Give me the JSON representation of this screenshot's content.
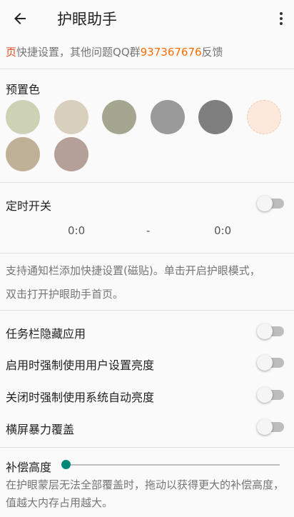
{
  "appbar": {
    "title": "护眼助手",
    "back_icon": "arrow-back-icon",
    "more_icon": "more-vert-icon"
  },
  "notice": {
    "prefix": "页",
    "text": "快捷设置，其他问题QQ群",
    "qq": "937367676",
    "suffix": "反馈"
  },
  "presets": {
    "label": "预置色",
    "colors": [
      "#cdd2b4",
      "#d8d0bd",
      "#a5a68f",
      "#9a9a9a",
      "#7f7f7f",
      "#fde8dc",
      "#bfb197",
      "#b4a099"
    ]
  },
  "timer": {
    "label": "定时开关",
    "enabled": false,
    "start": "0:0",
    "separator": "-",
    "end": "0:0"
  },
  "tile_desc": {
    "line1": "支持通知栏添加快捷设置(磁贴)。单击开启护眼模式，",
    "line2": "双击打开护眼助手首页。"
  },
  "toggles": [
    {
      "label": "任务栏隐藏应用",
      "enabled": false
    },
    {
      "label": "启用时强制使用用户设置亮度",
      "enabled": false
    },
    {
      "label": "关闭时强制使用系统自动亮度",
      "enabled": false
    },
    {
      "label": "横屏暴力覆盖",
      "enabled": false
    }
  ],
  "compensation": {
    "label": "补偿高度",
    "value_fraction": 0,
    "desc_line1": "在护眼蒙层无法全部覆盖时，拖动以获得更大的补偿高度，",
    "desc_line2": "值越大内存占用越大。",
    "accent": "#00897b"
  }
}
